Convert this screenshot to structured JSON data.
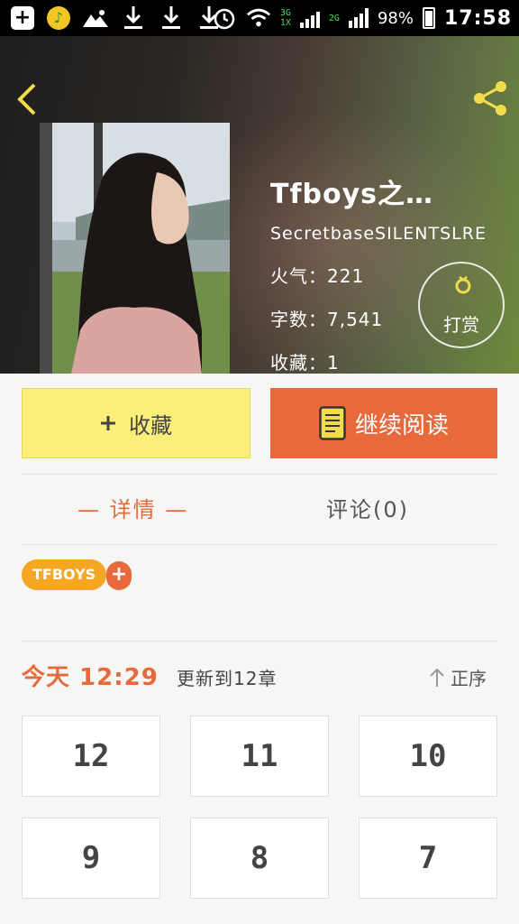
{
  "status_bar": {
    "network_top": "3G",
    "network_bottom": "1X",
    "network_2g": "2G",
    "battery": "98%",
    "time": "17:58"
  },
  "header": {
    "back_icon": "chevron-left-icon",
    "share_icon": "share-icon",
    "accent_color": "#f3dc4c"
  },
  "book": {
    "title": "Tfboys之…",
    "author": "SecretbaseSILENTSLRE",
    "popularity": "火气：221",
    "words": "字数：7,541",
    "favorites": "收藏：1",
    "reward_label": "打赏"
  },
  "actions": {
    "favorite_label": "收藏",
    "favorite_icon": "plus-icon",
    "read_label": "继续阅读",
    "read_icon": "book-icon"
  },
  "tabs": [
    {
      "label": "— 详情 —",
      "active": true
    },
    {
      "label": "评论(0)",
      "active": false
    }
  ],
  "tags": {
    "items": [
      "TFBOYS"
    ],
    "add_label": "+"
  },
  "updates": {
    "date": "今天 12:29",
    "text": "更新到12章",
    "sort_label": "正序",
    "sort_icon": "arrow-up-icon"
  },
  "chapters": [
    "12",
    "11",
    "10",
    "9",
    "8",
    "7"
  ]
}
